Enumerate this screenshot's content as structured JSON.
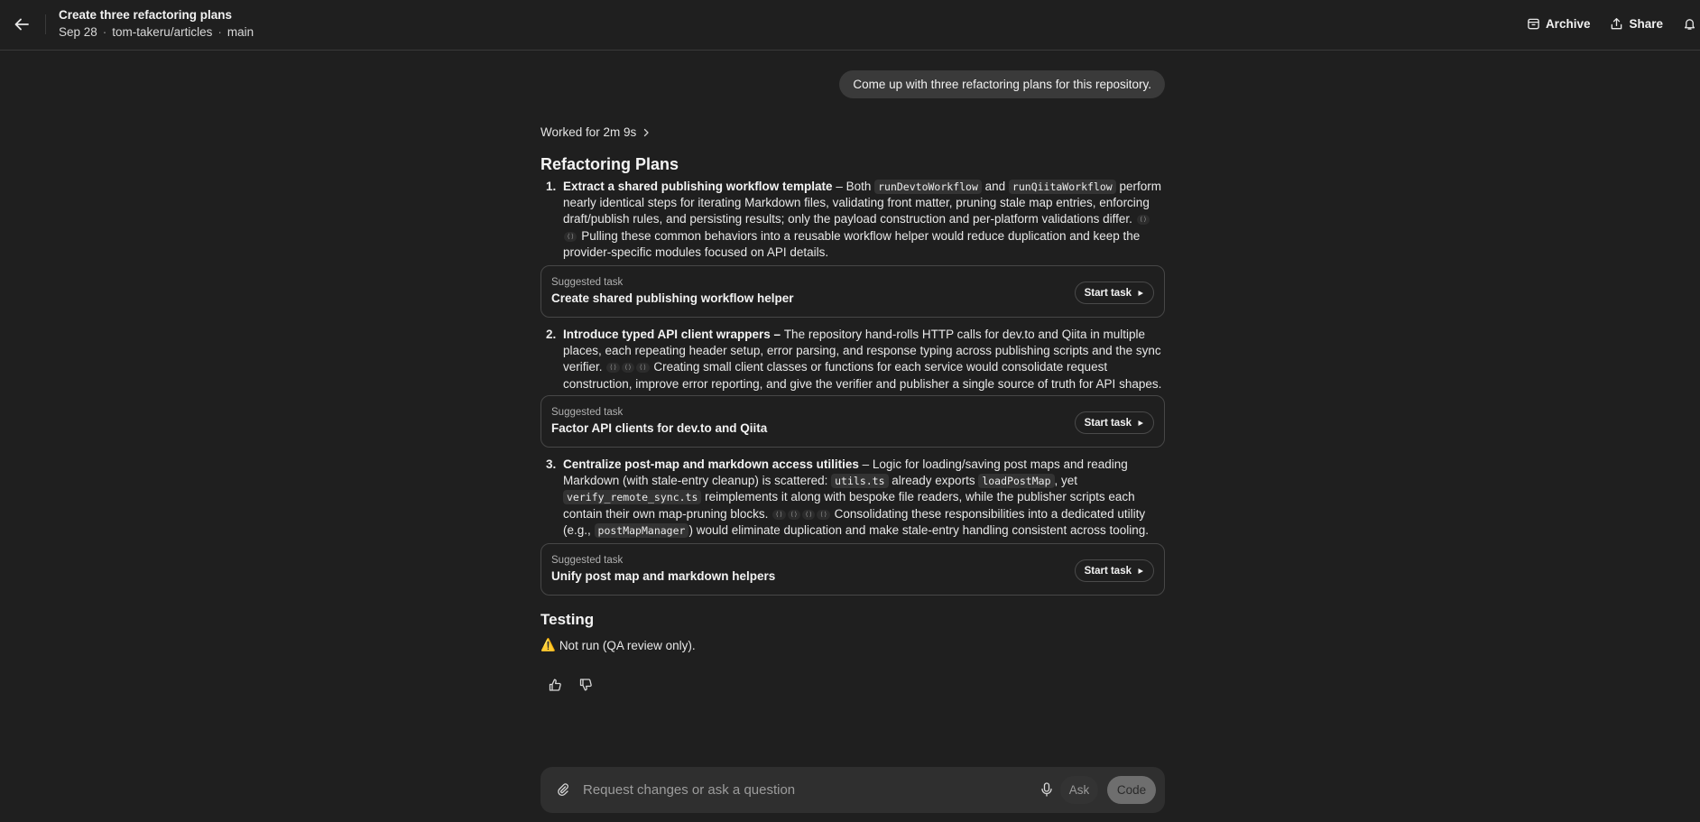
{
  "header": {
    "title": "Create three refactoring plans",
    "date": "Sep 28",
    "repo": "tom-takeru/articles",
    "branch": "main",
    "separator": "·",
    "archive_label": "Archive",
    "share_label": "Share"
  },
  "conversation": {
    "user_message": "Come up with three refactoring plans for this repository.",
    "worked_for": "Worked for 2m 9s",
    "plans_heading": "Refactoring Plans",
    "plans": [
      {
        "number": "1.",
        "title": "Extract a shared publishing workflow template",
        "dash": " – Both ",
        "code_a": "runDevtoWorkflow",
        "and": " and ",
        "code_b": "runQiitaWorkflow",
        "body_a": " perform nearly identical steps for iterating Markdown files, validating front matter, pruning stale map entries, enforcing draft/publish rules, and persisting results; only the payload construction and per-platform validations differ. ",
        "body_b": " Pulling these common behaviors into a reusable workflow helper would reduce duplication and keep the provider-specific modules focused on API details.",
        "task_label": "Suggested task",
        "task_title": "Create shared publishing workflow helper"
      },
      {
        "number": "2.",
        "title": "Introduce typed API client wrappers",
        "dash": " – ",
        "body_a": "The repository hand-rolls HTTP calls for dev.to and Qiita in multiple places, each repeating header setup, error parsing, and response typing across publishing scripts and the sync verifier. ",
        "body_b": " Creating small client classes or functions for each service would consolidate request construction, improve error reporting, and give the verifier and publisher a single source of truth for API shapes.",
        "task_label": "Suggested task",
        "task_title": "Factor API clients for dev.to and Qiita"
      },
      {
        "number": "3.",
        "title": "Centralize post-map and markdown access utilities",
        "dash": " – ",
        "body_a": "Logic for loading/saving post maps and reading Markdown (with stale-entry cleanup) is scattered: ",
        "code_a": "utils.ts",
        "mid_a": " already exports ",
        "code_b": "loadPostMap",
        "mid_b": ", yet ",
        "code_c": "verify_remote_sync.ts",
        "body_b": " reimplements it along with bespoke file readers, while the publisher scripts each contain their own map-pruning blocks. ",
        "body_c": " Consolidating these responsibilities into a dedicated utility (e.g., ",
        "code_d": "postMapManager",
        "body_d": ") would eliminate duplication and make stale-entry handling consistent across tooling.",
        "task_label": "Suggested task",
        "task_title": "Unify post map and markdown helpers"
      }
    ],
    "cite_glyph": "⟨⟩",
    "start_task_label": "Start task",
    "testing_heading": "Testing",
    "testing_warning": "⚠️",
    "testing_text": "Not run (QA review only)."
  },
  "composer": {
    "placeholder": "Request changes or ask a question",
    "ask_label": "Ask",
    "code_label": "Code"
  },
  "icons": [
    "back-arrow-icon",
    "archive-icon",
    "share-icon",
    "bell-icon",
    "chevron-right-icon",
    "play-icon",
    "thumbs-up-icon",
    "thumbs-down-icon",
    "paperclip-icon",
    "microphone-icon"
  ]
}
